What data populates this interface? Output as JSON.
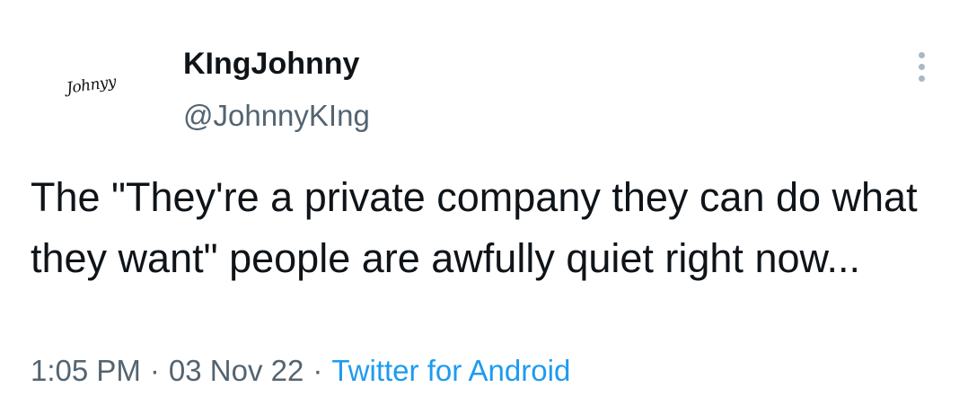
{
  "user": {
    "display_name": "KIngJohnny",
    "handle": "@JohnnyKIng",
    "avatar_signature": "Johnyy"
  },
  "tweet": {
    "text": "The \"They're a private company they can do what they want\" people are awfully quiet right now...",
    "time": "1:05 PM",
    "date": "03 Nov 22",
    "separator": "·",
    "source": "Twitter for Android"
  },
  "icons": {
    "more": "more-vertical-icon"
  },
  "colors": {
    "text": "#0f1419",
    "secondary": "#536471",
    "link": "#1d9bf0"
  }
}
